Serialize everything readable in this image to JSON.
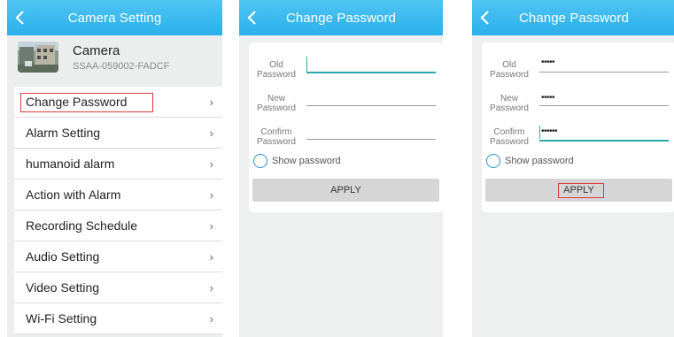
{
  "camera_setting": {
    "title": "Camera Setting",
    "camera_name": "Camera",
    "camera_id": "SSAA-059002-FADCF",
    "menu": [
      {
        "label": "Change Password",
        "selected": true
      },
      {
        "label": "Alarm Setting"
      },
      {
        "label": "humanoid alarm"
      },
      {
        "label": "Action with Alarm"
      },
      {
        "label": "Recording Schedule"
      },
      {
        "label": "Audio Setting"
      },
      {
        "label": "Video Setting"
      },
      {
        "label": "Wi-Fi Setting"
      }
    ],
    "chevron": "›"
  },
  "change_password_empty": {
    "title": "Change Password",
    "old_label": "Old Password",
    "new_label": "New Password",
    "confirm_label": "Confirm Password",
    "old_value": "",
    "new_value": "",
    "confirm_value": "",
    "show_password": "Show password",
    "apply": "APPLY"
  },
  "change_password_filled": {
    "title": "Change Password",
    "old_label": "Old Password",
    "new_label": "New Password",
    "confirm_label": "Confirm Password",
    "old_value": "•••••",
    "new_value": "•••••",
    "confirm_value": "••••••",
    "show_password": "Show password",
    "apply": "APPLY"
  },
  "colors": {
    "titlebar": "#2ab0ea",
    "highlight": "#e03a3a",
    "active_line": "#2aa9a9"
  }
}
